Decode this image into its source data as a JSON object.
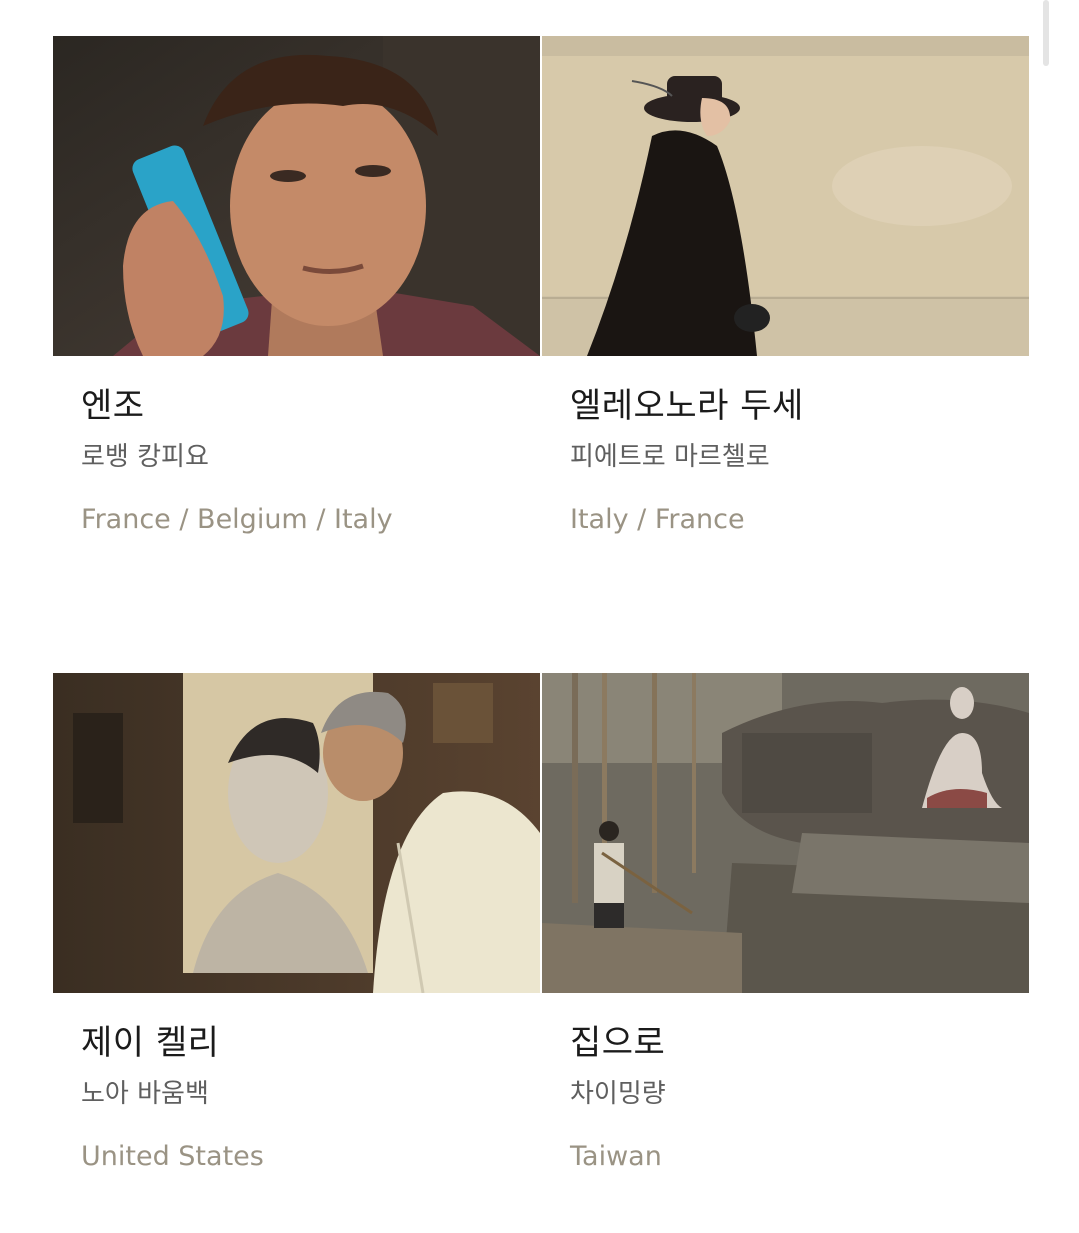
{
  "films": [
    {
      "title": "엔조",
      "director": "로뱅 캉피요",
      "country": "France / Belgium / Italy",
      "thumbnail_icon": "film-still-boy-on-phone"
    },
    {
      "title": "엘레오노라 두세",
      "director": "피에트로 마르첼로",
      "country": "Italy / France",
      "thumbnail_icon": "film-still-woman-in-black-hat"
    },
    {
      "title": "제이 켈리",
      "director": "노아 바움백",
      "country": "United States",
      "thumbnail_icon": "film-still-man-in-white-suit"
    },
    {
      "title": "집으로",
      "director": "차이밍량",
      "country": "Taiwan",
      "thumbnail_icon": "film-still-temple-rocks"
    }
  ],
  "colors": {
    "title": "#1b1b1b",
    "director": "#5f5f5f",
    "country": "#9a9384",
    "background": "#ffffff"
  }
}
